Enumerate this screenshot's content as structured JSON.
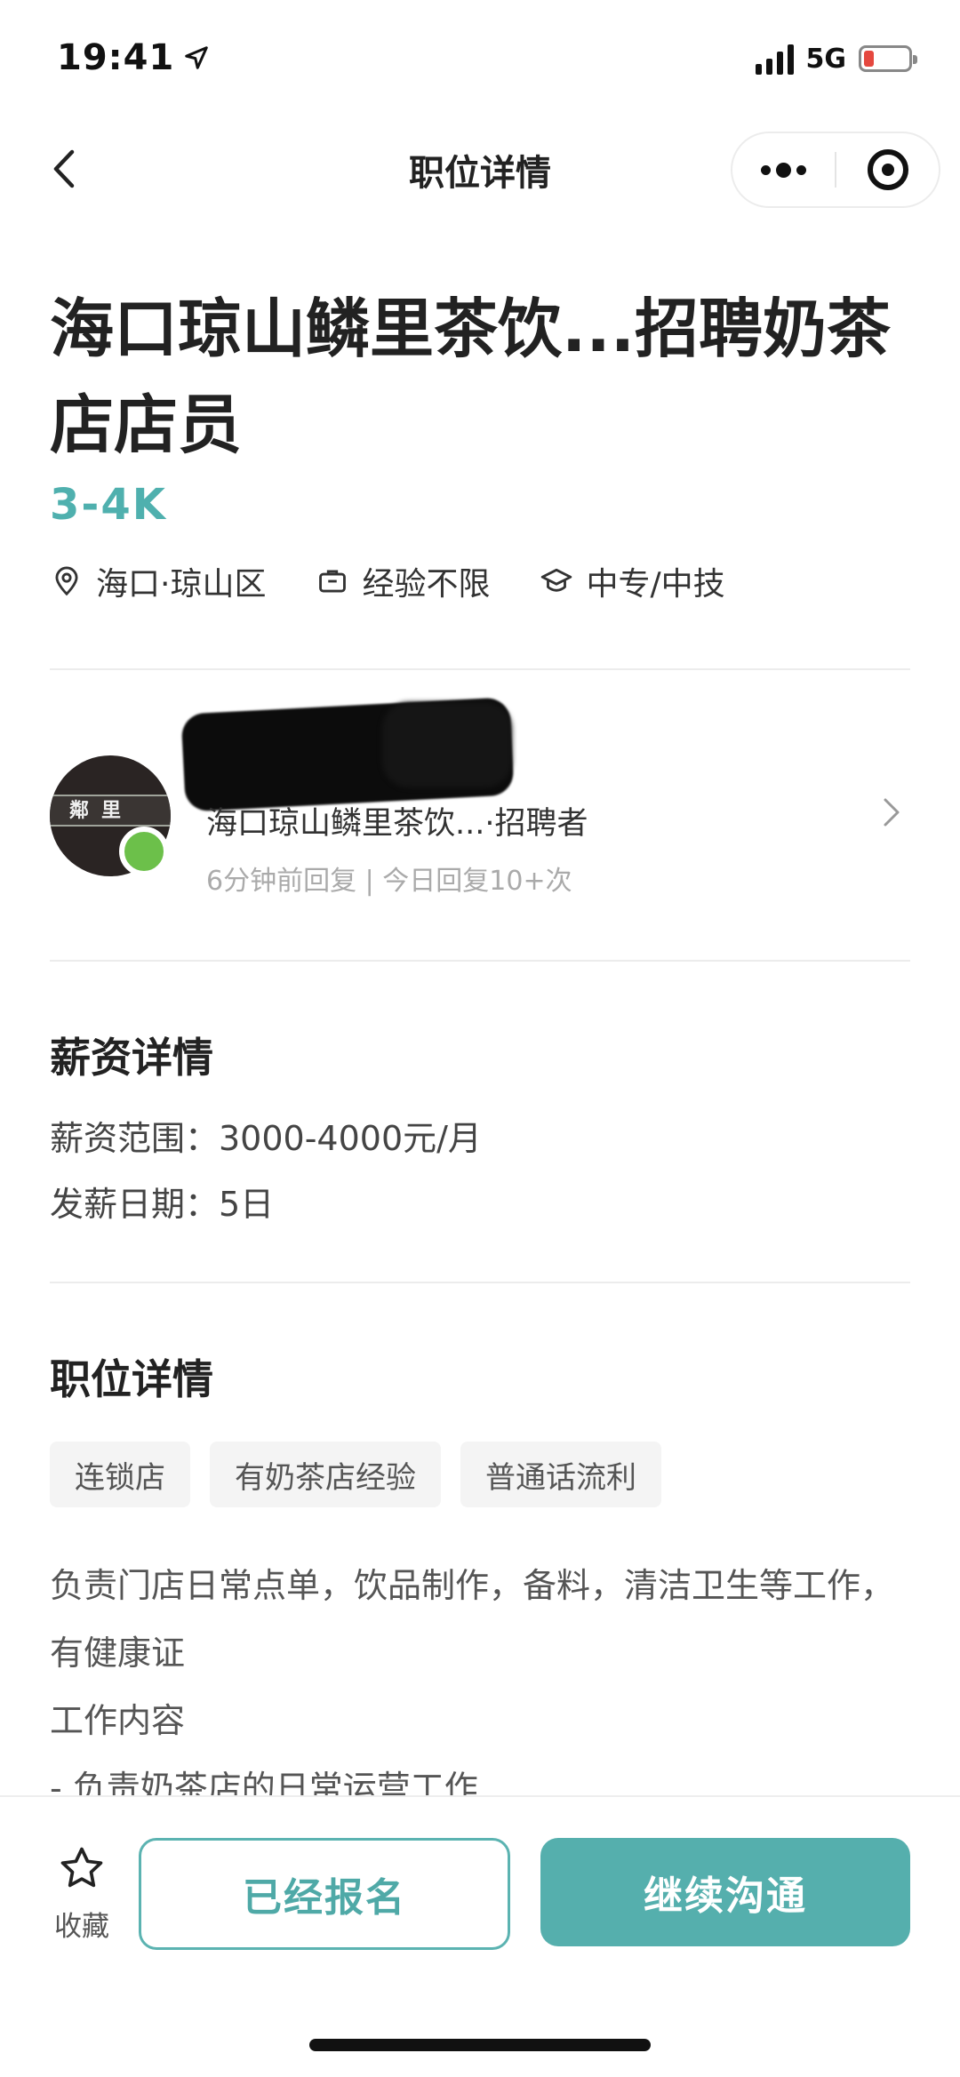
{
  "status_bar": {
    "time": "19:41",
    "network": "5G",
    "battery_level": 0.22
  },
  "nav": {
    "title": "职位详情"
  },
  "job": {
    "title": "海口琼山鳞里茶饮...招聘奶茶店店员",
    "salary": "3-4K",
    "location": "海口·琼山区",
    "experience": "经验不限",
    "education": "中专/中技"
  },
  "recruiter": {
    "avatar_text": "鄰里",
    "company_role": "海口琼山鳞里茶饮...·招聘者",
    "reply_info": "6分钟前回复 | 今日回复10+次"
  },
  "salary_section": {
    "title": "薪资详情",
    "range": "薪资范围：3000-4000元/月",
    "pay_day": "发薪日期：5日"
  },
  "position_section": {
    "title": "职位详情",
    "tags": [
      "连锁店",
      "有奶茶店经验",
      "普通话流利"
    ],
    "description_lines": [
      "负责门店日常点单，饮品制作，备料，清洁卫生等工作，有健康证",
      "工作内容",
      "- 负责奶茶店的日常运营工作"
    ]
  },
  "bottom_bar": {
    "favorite_label": "收藏",
    "applied_label": "已经报名",
    "continue_label": "继续沟通"
  },
  "colors": {
    "accent": "#55afad",
    "online": "#6cc04a",
    "battery_low": "#e5483f"
  },
  "icons": {
    "back": "chevron-left-icon",
    "more": "more-dots-icon",
    "close_target": "target-icon",
    "location": "location-pin-icon",
    "experience": "briefcase-icon",
    "education": "graduation-cap-icon",
    "favorite": "star-icon"
  }
}
